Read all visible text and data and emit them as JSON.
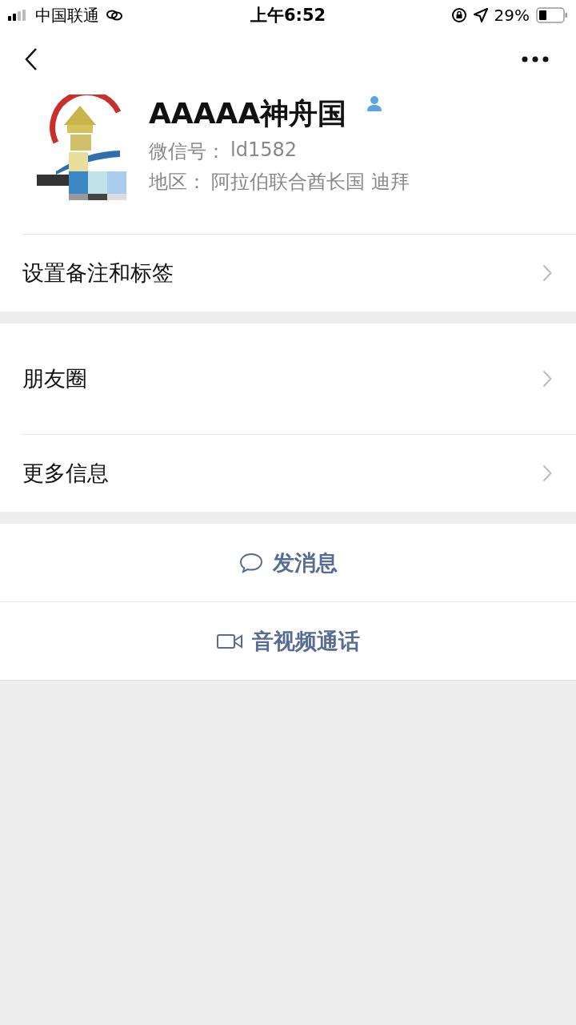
{
  "status_bar": {
    "carrier": "中国联通",
    "time": "上午6:52",
    "battery": "29%"
  },
  "profile": {
    "name": "AAAAA神舟国",
    "wechat_id_label": "微信号：",
    "wechat_id": "ld1582",
    "region_label": "地区：",
    "region": "阿拉伯联合酋长国 迪拜"
  },
  "menu_groups": [
    [
      {
        "label": "设置备注和标签"
      }
    ],
    [
      {
        "label": "朋友圈"
      },
      {
        "label": "更多信息"
      }
    ]
  ],
  "actions": [
    {
      "kind": "message",
      "label": "发消息"
    },
    {
      "kind": "call",
      "label": "音视频通话"
    }
  ]
}
